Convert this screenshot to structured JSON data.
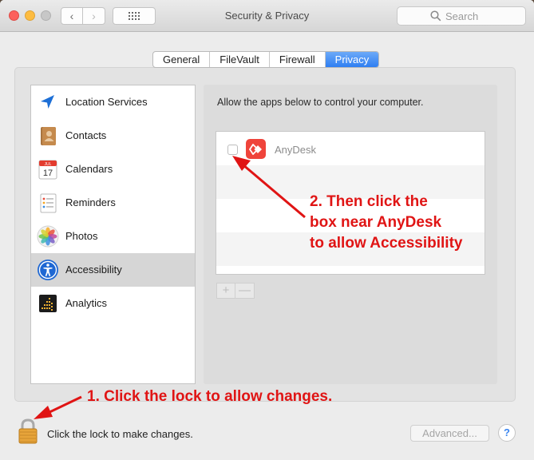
{
  "window": {
    "title": "Security & Privacy",
    "search_placeholder": "Search",
    "nav_back_glyph": "‹",
    "nav_forward_glyph": "›"
  },
  "tabs": [
    {
      "label": "General",
      "active": false
    },
    {
      "label": "FileVault",
      "active": false
    },
    {
      "label": "Firewall",
      "active": false
    },
    {
      "label": "Privacy",
      "active": true
    }
  ],
  "sidebar": {
    "items": [
      {
        "label": "Location Services",
        "icon": "location-arrow-icon",
        "selected": false
      },
      {
        "label": "Contacts",
        "icon": "contacts-book-icon",
        "selected": false
      },
      {
        "label": "Calendars",
        "icon": "calendar-icon",
        "selected": false,
        "icon_month": "JUL",
        "icon_day": "17"
      },
      {
        "label": "Reminders",
        "icon": "reminders-list-icon",
        "selected": false
      },
      {
        "label": "Photos",
        "icon": "photos-flower-icon",
        "selected": false
      },
      {
        "label": "Accessibility",
        "icon": "accessibility-icon",
        "selected": true
      },
      {
        "label": "Analytics",
        "icon": "analytics-icon",
        "selected": false
      }
    ]
  },
  "accessibility_pane": {
    "instruction": "Allow the apps below to control your computer.",
    "apps": [
      {
        "name": "AnyDesk",
        "checked": false,
        "icon": "anydesk-icon"
      }
    ],
    "add_label": "+",
    "remove_label": "—"
  },
  "annotations": {
    "step2_line1": "2. Then click the",
    "step2_line2": "box near AnyDesk",
    "step2_line3": "to allow Accessibility",
    "step1": "1. Click the lock to allow changes.",
    "color": "#e01414"
  },
  "footer": {
    "lock_text": "Click the lock to make changes.",
    "advanced_label": "Advanced...",
    "help_label": "?"
  }
}
